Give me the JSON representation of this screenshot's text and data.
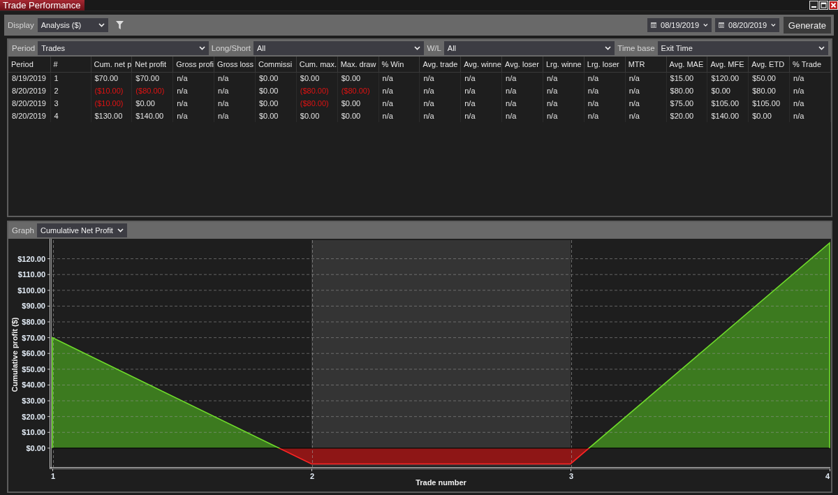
{
  "window": {
    "title": "Trade Performance"
  },
  "toolbar": {
    "display_label": "Display",
    "display_value": "Analysis ($)",
    "start_date": "08/19/2019",
    "end_date": "08/20/2019",
    "generate_button": "Generate"
  },
  "filters": [
    {
      "label": "Period",
      "value": "Trades"
    },
    {
      "label": "Long/Short",
      "value": "All"
    },
    {
      "label": "W/L",
      "value": "All"
    },
    {
      "label": "Time base",
      "value": "Exit Time"
    }
  ],
  "table": {
    "columns": [
      "Period",
      "#",
      "Cum. net p",
      "Net profit",
      "Gross profi",
      "Gross loss",
      "Commissi",
      "Cum. max.",
      "Max. draw",
      "% Win",
      "Avg. trade",
      "Avg. winne",
      "Avg. loser",
      "Lrg. winne",
      "Lrg. loser",
      "MTR",
      "Avg. MAE",
      "Avg. MFE",
      "Avg. ETD",
      "% Trade"
    ],
    "rows": [
      {
        "cells": [
          {
            "text": "8/19/2019",
            "negative": false
          },
          {
            "text": "1",
            "negative": false
          },
          {
            "text": "$70.00",
            "negative": false
          },
          {
            "text": "$70.00",
            "negative": false
          },
          {
            "text": "n/a",
            "negative": false
          },
          {
            "text": "n/a",
            "negative": false
          },
          {
            "text": "$0.00",
            "negative": false
          },
          {
            "text": "$0.00",
            "negative": false
          },
          {
            "text": "$0.00",
            "negative": false
          },
          {
            "text": "n/a",
            "negative": false
          },
          {
            "text": "n/a",
            "negative": false
          },
          {
            "text": "n/a",
            "negative": false
          },
          {
            "text": "n/a",
            "negative": false
          },
          {
            "text": "n/a",
            "negative": false
          },
          {
            "text": "n/a",
            "negative": false
          },
          {
            "text": "n/a",
            "negative": false
          },
          {
            "text": "$15.00",
            "negative": false
          },
          {
            "text": "$120.00",
            "negative": false
          },
          {
            "text": "$50.00",
            "negative": false
          },
          {
            "text": "n/a",
            "negative": false
          }
        ]
      },
      {
        "cells": [
          {
            "text": "8/20/2019",
            "negative": false
          },
          {
            "text": "2",
            "negative": false
          },
          {
            "text": "($10.00)",
            "negative": true
          },
          {
            "text": "($80.00)",
            "negative": true
          },
          {
            "text": "n/a",
            "negative": false
          },
          {
            "text": "n/a",
            "negative": false
          },
          {
            "text": "$0.00",
            "negative": false
          },
          {
            "text": "($80.00)",
            "negative": true
          },
          {
            "text": "($80.00)",
            "negative": true
          },
          {
            "text": "n/a",
            "negative": false
          },
          {
            "text": "n/a",
            "negative": false
          },
          {
            "text": "n/a",
            "negative": false
          },
          {
            "text": "n/a",
            "negative": false
          },
          {
            "text": "n/a",
            "negative": false
          },
          {
            "text": "n/a",
            "negative": false
          },
          {
            "text": "n/a",
            "negative": false
          },
          {
            "text": "$80.00",
            "negative": false
          },
          {
            "text": "$0.00",
            "negative": false
          },
          {
            "text": "$80.00",
            "negative": false
          },
          {
            "text": "n/a",
            "negative": false
          }
        ]
      },
      {
        "cells": [
          {
            "text": "8/20/2019",
            "negative": false
          },
          {
            "text": "3",
            "negative": false
          },
          {
            "text": "($10.00)",
            "negative": true
          },
          {
            "text": "$0.00",
            "negative": false
          },
          {
            "text": "n/a",
            "negative": false
          },
          {
            "text": "n/a",
            "negative": false
          },
          {
            "text": "$0.00",
            "negative": false
          },
          {
            "text": "($80.00)",
            "negative": true
          },
          {
            "text": "$0.00",
            "negative": false
          },
          {
            "text": "n/a",
            "negative": false
          },
          {
            "text": "n/a",
            "negative": false
          },
          {
            "text": "n/a",
            "negative": false
          },
          {
            "text": "n/a",
            "negative": false
          },
          {
            "text": "n/a",
            "negative": false
          },
          {
            "text": "n/a",
            "negative": false
          },
          {
            "text": "n/a",
            "negative": false
          },
          {
            "text": "$75.00",
            "negative": false
          },
          {
            "text": "$105.00",
            "negative": false
          },
          {
            "text": "$105.00",
            "negative": false
          },
          {
            "text": "n/a",
            "negative": false
          }
        ]
      },
      {
        "cells": [
          {
            "text": "8/20/2019",
            "negative": false
          },
          {
            "text": "4",
            "negative": false
          },
          {
            "text": "$130.00",
            "negative": false
          },
          {
            "text": "$140.00",
            "negative": false
          },
          {
            "text": "n/a",
            "negative": false
          },
          {
            "text": "n/a",
            "negative": false
          },
          {
            "text": "$0.00",
            "negative": false
          },
          {
            "text": "$0.00",
            "negative": false
          },
          {
            "text": "$0.00",
            "negative": false
          },
          {
            "text": "n/a",
            "negative": false
          },
          {
            "text": "n/a",
            "negative": false
          },
          {
            "text": "n/a",
            "negative": false
          },
          {
            "text": "n/a",
            "negative": false
          },
          {
            "text": "n/a",
            "negative": false
          },
          {
            "text": "n/a",
            "negative": false
          },
          {
            "text": "n/a",
            "negative": false
          },
          {
            "text": "$20.00",
            "negative": false
          },
          {
            "text": "$140.00",
            "negative": false
          },
          {
            "text": "$0.00",
            "negative": false
          },
          {
            "text": "n/a",
            "negative": false
          }
        ]
      }
    ]
  },
  "graph": {
    "label": "Graph",
    "value": "Cumulative Net Profit",
    "chart_data": {
      "type": "area",
      "xlabel": "Trade number",
      "ylabel": "Cumulative profit ($)",
      "x": [
        1,
        2,
        3,
        4
      ],
      "series": [
        {
          "color": "#3c7a1f",
          "values": [
            70,
            -10,
            -10,
            130
          ]
        }
      ],
      "xlim": [
        1,
        4
      ],
      "ylim": [
        -12,
        130
      ],
      "xticks": [
        1,
        2,
        3,
        4
      ],
      "yticks": [
        {
          "value": 0,
          "label": "$0.00"
        },
        {
          "value": 10,
          "label": "$10.00"
        },
        {
          "value": 20,
          "label": "$20.00"
        },
        {
          "value": 30,
          "label": "$30.00"
        },
        {
          "value": 40,
          "label": "$40.00"
        },
        {
          "value": 50,
          "label": "$50.00"
        },
        {
          "value": 60,
          "label": "$60.00"
        },
        {
          "value": 70,
          "label": "$70.00"
        },
        {
          "value": 80,
          "label": "$80.00"
        },
        {
          "value": 90,
          "label": "$90.00"
        },
        {
          "value": 100,
          "label": "$100.00"
        },
        {
          "value": 110,
          "label": "$110.00"
        },
        {
          "value": 120,
          "label": "$120.00"
        }
      ],
      "grid": true,
      "bands": [
        {
          "axis": "x",
          "from": 2,
          "to": 3
        }
      ]
    }
  }
}
